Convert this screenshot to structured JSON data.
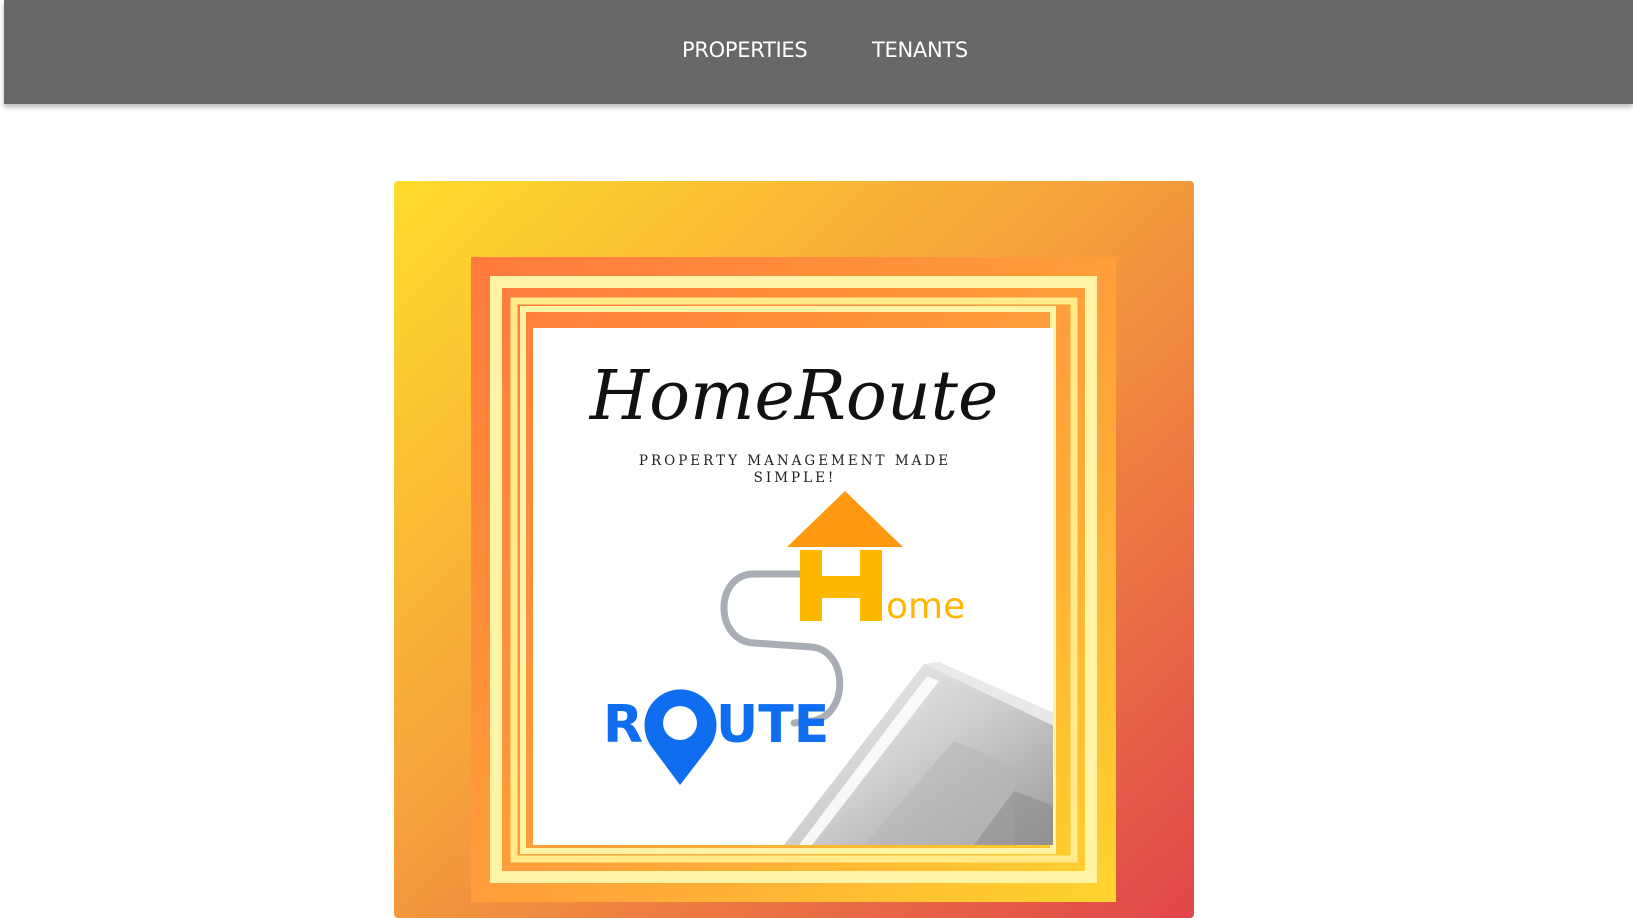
{
  "nav": {
    "items": [
      {
        "label": "PROPERTIES"
      },
      {
        "label": "TENANTS"
      }
    ]
  },
  "logo": {
    "title": "HomeRoute",
    "tagline_line1": "PROPERTY MANAGEMENT MADE",
    "tagline_line2": "SIMPLE!",
    "home_word": "ome",
    "route_r": "R",
    "route_rest": "UTE",
    "colors": {
      "frame_gold": "#FFD52E",
      "frame_orange": "#F2893A",
      "frame_red": "#E2484A",
      "cream": "#FFF3A6",
      "house_roof": "#FF9A10",
      "house_h": "#FFB800",
      "route_blue": "#0F6EF0",
      "road_gray": "#A9AEB5"
    }
  }
}
